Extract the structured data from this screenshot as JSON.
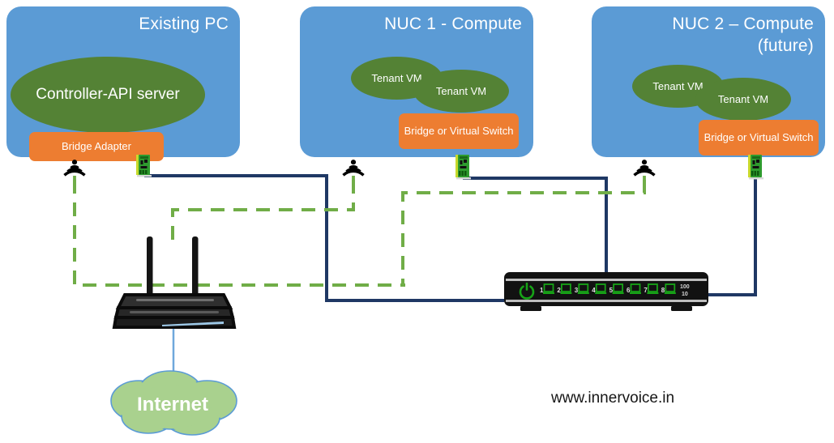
{
  "diagram": {
    "title": "Network topology: Controller PC, NUC compute nodes, switch, router and Internet",
    "watermark": "www.innervoice.in",
    "colors": {
      "host_box": "#5B9BD5",
      "vm_ellipse": "#548235",
      "bridge_chip": "#ED7D31",
      "wired_link": "#1F3864",
      "wireless_link": "#70AD47",
      "cloud_fill": "#A9D18E",
      "cloud_stroke": "#5B9BD5",
      "device_body": "#262626",
      "nic_green": "#2E9B2E",
      "led_green": "#17A317"
    }
  },
  "hosts": [
    {
      "id": "existing-pc",
      "title": "Existing PC",
      "vms": [
        {
          "label": "Controller-API\nserver"
        }
      ],
      "bridge": "Bridge Adapter"
    },
    {
      "id": "nuc-1",
      "title": "NUC 1 - Compute",
      "vms": [
        {
          "label": "Tenant\nVM"
        },
        {
          "label": "Tenant\nVM"
        }
      ],
      "bridge": "Bridge or Virtual\nSwitch"
    },
    {
      "id": "nuc-2",
      "title": "NUC 2 – Compute\n(future)",
      "vms": [
        {
          "label": "Tenant\nVM"
        },
        {
          "label": "Tenant\nVM"
        }
      ],
      "bridge": "Bridge or Virtual\nSwitch"
    }
  ],
  "devices": {
    "wifi_adapters": [
      {
        "for": "existing-pc"
      },
      {
        "for": "nuc-1"
      },
      {
        "for": "nuc-2"
      }
    ],
    "nic_cards": [
      {
        "for": "existing-pc"
      },
      {
        "for": "nuc-1"
      },
      {
        "for": "nuc-2"
      }
    ],
    "router": {
      "name": "Wireless router",
      "antennas": 2
    },
    "switch": {
      "name": "8-port Ethernet switch",
      "power_label": "⏻",
      "ports": [
        "1",
        "2",
        "3",
        "4",
        "5",
        "6",
        "7",
        "8"
      ],
      "speed_top": "100",
      "speed_bottom": "10"
    },
    "cloud": {
      "label": "Internet"
    }
  }
}
